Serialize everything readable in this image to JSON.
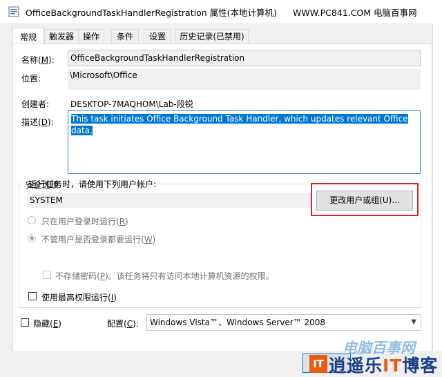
{
  "window": {
    "title": "OfficeBackgroundTaskHandlerRegistration 属性(本地计算机)",
    "watermark_top": "WWW.PC841.COM 电脑百事网"
  },
  "tabs": [
    {
      "label": "常规",
      "active": true
    },
    {
      "label": "触发器",
      "active": false
    },
    {
      "label": "操作",
      "active": false
    },
    {
      "label": "条件",
      "active": false
    },
    {
      "label": "设置",
      "active": false
    },
    {
      "label": "历史记录(已禁用)",
      "active": false
    }
  ],
  "general": {
    "name_label": "名称(",
    "name_key": "M",
    "name_suffix": "):",
    "name_value": "OfficeBackgroundTaskHandlerRegistration",
    "location_label": "位置:",
    "location_value": "\\Microsoft\\Office",
    "author_label": "创建者:",
    "author_value": "DESKTOP-7MAQHOM\\Lab-段锐",
    "description_label": "描述(",
    "description_key": "D",
    "description_suffix": "):",
    "description_value": "This task initiates Office Background Task Handler, which updates relevant Office data."
  },
  "security": {
    "group_title": "安全选项",
    "run_as_label": "运行任务时，请使用下列用户帐户:",
    "user_account": "SYSTEM",
    "change_user_button": "更改用户或组(U)...",
    "radio_logged_on": "只在用户登录时运行(",
    "radio_logged_on_key": "R",
    "radio_logged_on_suffix": ")",
    "radio_logged_on_selected": false,
    "radio_whether": "不管用户是否登录都要运行(",
    "radio_whether_key": "W",
    "radio_whether_suffix": ")",
    "radio_whether_selected": true,
    "no_store_password": "不存储密码(",
    "no_store_password_key": "P",
    "no_store_password_suffix": ")。该任务将只有访问本地计算机资源的权限。",
    "no_store_password_checked": false,
    "highest_privileges": "使用最高权限运行(",
    "highest_privileges_key": "I",
    "highest_privileges_suffix": ")",
    "highest_privileges_checked": false
  },
  "footer": {
    "hidden_label": "隐藏(",
    "hidden_key": "E",
    "hidden_suffix": ")",
    "hidden_checked": false,
    "configure_label": "配置(",
    "configure_key": "C",
    "configure_suffix": "):",
    "configure_value": "Windows Vista™、Windows Server™ 2008"
  },
  "watermark": {
    "line1": "电脑百事网",
    "logo": "IT",
    "line2a": "逍遥乐",
    "line2b": "IT",
    "line2c": "博客"
  }
}
